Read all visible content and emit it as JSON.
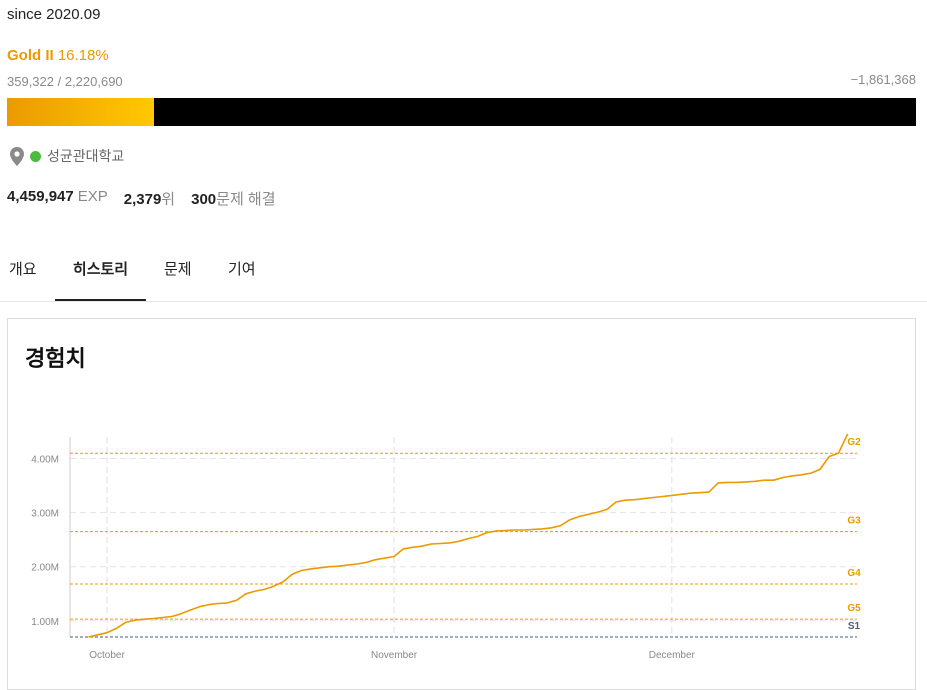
{
  "profile": {
    "since": "since 2020.09",
    "tier_name": "Gold II",
    "tier_percent": "16.18%",
    "rating_text": "359,322 / 2,220,690",
    "rating_diff": "−1,861,368",
    "progress_fraction": 0.1618,
    "school": "성균관대학교",
    "school_status_color": "#4cba3f",
    "exp_value": "4,459,947",
    "exp_unit": "EXP",
    "rank_value": "2,379",
    "rank_unit": "위",
    "solved_value": "300",
    "solved_unit": "문제 해결",
    "accent_color": "#eb9a00"
  },
  "icons": {
    "location": "map-pin-icon"
  },
  "tabs": [
    {
      "label": "개요",
      "active": false
    },
    {
      "label": "히스토리",
      "active": true
    },
    {
      "label": "문제",
      "active": false
    },
    {
      "label": "기여",
      "active": false
    }
  ],
  "card": {
    "title": "경험치"
  },
  "chart_data": {
    "type": "line",
    "title": "",
    "xlabel": "",
    "ylabel": "",
    "x_tick_labels": [
      "October",
      "November",
      "December"
    ],
    "x_ticks_day": [
      0,
      31,
      61
    ],
    "y_tick_labels": [
      "1.00M",
      "2.00M",
      "3.00M",
      "4.00M"
    ],
    "y_ticks": [
      1000000,
      2000000,
      3000000,
      4000000
    ],
    "ylim": [
      700000,
      4400000
    ],
    "xlim": [
      -4,
      81
    ],
    "grid": true,
    "series_color": "#eb9a00",
    "tier_lines": [
      {
        "label": "G2",
        "value": 4100000,
        "color": "#eb9a00"
      },
      {
        "label": "G3",
        "value": 2650000,
        "color": "#eb9a00"
      },
      {
        "label": "G4",
        "value": 1680000,
        "color": "#eb9a00"
      },
      {
        "label": "G5",
        "value": 1030000,
        "color": "#eb9a00"
      },
      {
        "label": "S1",
        "value": 700000,
        "color": "#435f7a"
      }
    ],
    "series": [
      {
        "points": [
          [
            -2,
            700000
          ],
          [
            -1,
            740000
          ],
          [
            0,
            780000
          ],
          [
            1,
            860000
          ],
          [
            2,
            970000
          ],
          [
            3,
            1010000
          ],
          [
            4,
            1030000
          ],
          [
            5,
            1040000
          ],
          [
            6,
            1060000
          ],
          [
            7,
            1080000
          ],
          [
            8,
            1130000
          ],
          [
            9,
            1200000
          ],
          [
            10,
            1260000
          ],
          [
            11,
            1300000
          ],
          [
            12,
            1320000
          ],
          [
            13,
            1330000
          ],
          [
            14,
            1380000
          ],
          [
            15,
            1500000
          ],
          [
            16,
            1550000
          ],
          [
            17,
            1580000
          ],
          [
            18,
            1640000
          ],
          [
            19,
            1720000
          ],
          [
            20,
            1860000
          ],
          [
            21,
            1930000
          ],
          [
            22,
            1960000
          ],
          [
            23,
            1980000
          ],
          [
            24,
            2000000
          ],
          [
            25,
            2010000
          ],
          [
            26,
            2030000
          ],
          [
            27,
            2050000
          ],
          [
            28,
            2080000
          ],
          [
            29,
            2130000
          ],
          [
            30,
            2160000
          ],
          [
            31,
            2190000
          ],
          [
            32,
            2330000
          ],
          [
            33,
            2360000
          ],
          [
            34,
            2380000
          ],
          [
            35,
            2420000
          ],
          [
            36,
            2430000
          ],
          [
            37,
            2440000
          ],
          [
            38,
            2470000
          ],
          [
            39,
            2520000
          ],
          [
            40,
            2560000
          ],
          [
            41,
            2630000
          ],
          [
            42,
            2660000
          ],
          [
            43,
            2670000
          ],
          [
            44,
            2680000
          ],
          [
            45,
            2680000
          ],
          [
            46,
            2690000
          ],
          [
            47,
            2700000
          ],
          [
            48,
            2720000
          ],
          [
            49,
            2760000
          ],
          [
            50,
            2870000
          ],
          [
            51,
            2930000
          ],
          [
            52,
            2970000
          ],
          [
            53,
            3010000
          ],
          [
            54,
            3060000
          ],
          [
            55,
            3200000
          ],
          [
            56,
            3230000
          ],
          [
            57,
            3240000
          ],
          [
            58,
            3260000
          ],
          [
            59,
            3280000
          ],
          [
            60,
            3300000
          ],
          [
            61,
            3320000
          ],
          [
            62,
            3340000
          ],
          [
            63,
            3360000
          ],
          [
            64,
            3370000
          ],
          [
            65,
            3380000
          ],
          [
            66,
            3550000
          ],
          [
            67,
            3560000
          ],
          [
            68,
            3560000
          ],
          [
            69,
            3570000
          ],
          [
            70,
            3580000
          ],
          [
            71,
            3600000
          ],
          [
            72,
            3600000
          ],
          [
            73,
            3650000
          ],
          [
            74,
            3680000
          ],
          [
            75,
            3700000
          ],
          [
            76,
            3730000
          ],
          [
            77,
            3800000
          ],
          [
            78,
            4040000
          ],
          [
            79,
            4100000
          ],
          [
            80,
            4460000
          ]
        ]
      }
    ]
  }
}
